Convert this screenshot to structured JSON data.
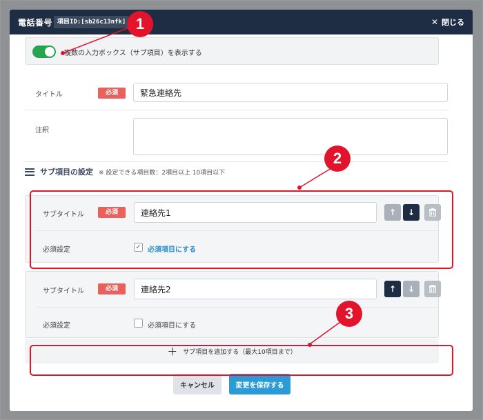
{
  "header": {
    "title": "電話番号",
    "item_id": "項目ID:[sb26c13nfk]",
    "close_label": "閉じる"
  },
  "toggle": {
    "label": "複数の入力ボックス（サブ項目）を表示する",
    "on": true
  },
  "fields": {
    "title_label": "タイトル",
    "required_badge": "必須",
    "title_value": "緊急連絡先",
    "note_label": "注釈",
    "note_value": ""
  },
  "sub_section": {
    "title": "サブ項目の設定",
    "note": "※ 設定できる項目数：2項目以上 10項目以下",
    "items": [
      {
        "subtitle_label": "サブタイトル",
        "badge": "必須",
        "value": "連絡先1",
        "required_label": "必須設定",
        "checkbox_label": "必須項目にする",
        "checked": true
      },
      {
        "subtitle_label": "サブタイトル",
        "badge": "必須",
        "value": "連絡先2",
        "required_label": "必須設定",
        "checkbox_label": "必須項目にする",
        "checked": false
      }
    ],
    "add_label": "サブ項目を追加する（最大10項目まで）"
  },
  "footer": {
    "cancel_label": "キャンセル",
    "save_label": "変更を保存する"
  },
  "callouts": [
    "1",
    "2",
    "3"
  ],
  "colors": {
    "header_bg": "#1e2d44",
    "accent_red": "#e2142c",
    "toggle_green": "#24a54e",
    "save_blue": "#2b9bd8",
    "badge_red": "#e8615d"
  }
}
